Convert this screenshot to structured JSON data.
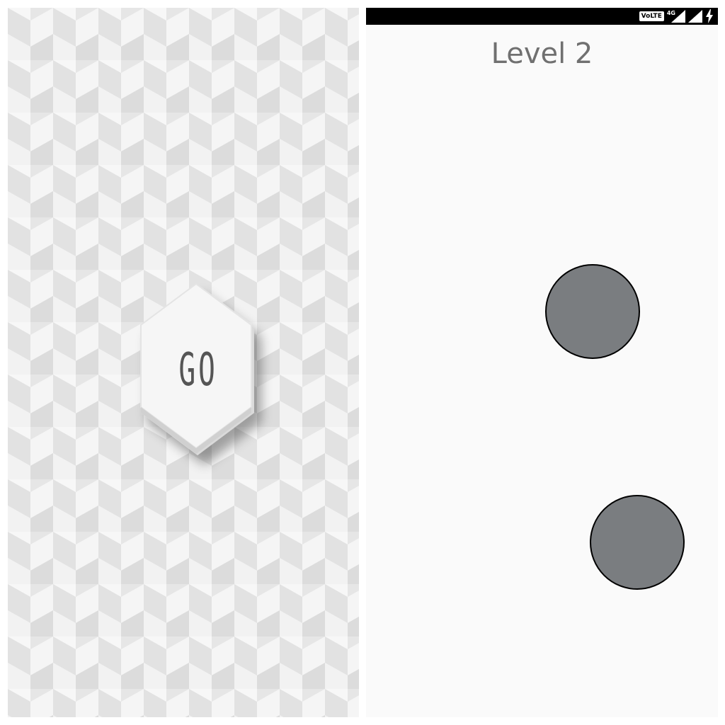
{
  "left_screen": {
    "go_button": {
      "label": "GO"
    },
    "colors": {
      "pattern_light": "#f4f4f4",
      "pattern_mid": "#e8e8e8",
      "pattern_dark": "#d9d9d9",
      "button_face": "#f5f5f5",
      "label": "#555555"
    }
  },
  "right_screen": {
    "status_bar": {
      "volte_badge": "VoLTE",
      "network_type": "4G",
      "icons": [
        "volte-icon",
        "signal-icon",
        "signal-icon",
        "battery-charging-icon"
      ]
    },
    "level_title": "Level 2",
    "balls": [
      {
        "name": "ball-1",
        "color": "#7a7d80"
      },
      {
        "name": "ball-2",
        "color": "#7a7d80"
      }
    ],
    "colors": {
      "background": "#fafafa",
      "title": "#707070",
      "status_bar": "#000000"
    }
  }
}
